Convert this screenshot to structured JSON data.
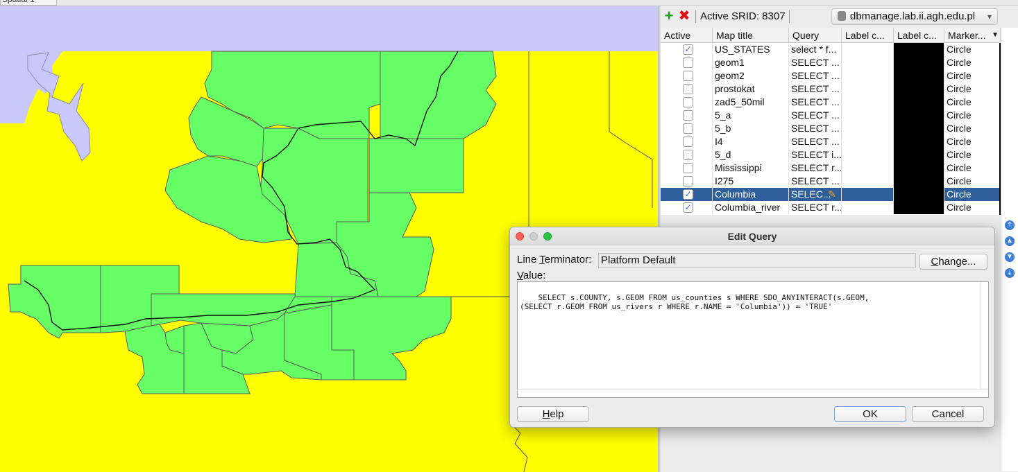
{
  "tab": {
    "label": "Spatial 1"
  },
  "toolbar": {
    "add_icon": "plus-icon",
    "remove_icon": "delete-x-icon",
    "active_srid": "Active SRID: 8307",
    "connection": "dbmanage.lab.ii.agh.edu.pl"
  },
  "table": {
    "headers": [
      "Active",
      "Map title",
      "Query",
      "Label c...",
      "Label c...",
      "Marker..."
    ],
    "rows": [
      {
        "active": true,
        "title": "US_STATES",
        "query": "select * f...",
        "marker": "Circle",
        "selected": false
      },
      {
        "active": false,
        "title": "geom1",
        "query": "SELECT ...",
        "marker": "Circle",
        "selected": false
      },
      {
        "active": false,
        "title": "geom2",
        "query": "SELECT ...",
        "marker": "Circle",
        "selected": false
      },
      {
        "active": false,
        "title": "prostokat",
        "query": "SELECT  ...",
        "marker": "Circle",
        "selected": false
      },
      {
        "active": false,
        "title": "zad5_50mil",
        "query": "SELECT ...",
        "marker": "Circle",
        "selected": false
      },
      {
        "active": false,
        "title": "5_a",
        "query": "SELECT ...",
        "marker": "Circle",
        "selected": false
      },
      {
        "active": false,
        "title": "5_b",
        "query": "SELECT ...",
        "marker": "Circle",
        "selected": false
      },
      {
        "active": false,
        "title": "I4",
        "query": "SELECT ...",
        "marker": "Circle",
        "selected": false
      },
      {
        "active": false,
        "title": "5_d",
        "query": "SELECT i...",
        "marker": "Circle",
        "selected": false
      },
      {
        "active": false,
        "title": "Mississippi",
        "query": "SELECT r...",
        "marker": "Circle",
        "selected": false
      },
      {
        "active": false,
        "title": "I275",
        "query": "SELECT ...",
        "marker": "Circle",
        "selected": false
      },
      {
        "active": true,
        "title": "Columbia",
        "query": "SELEC...",
        "marker": "Circle",
        "selected": true
      },
      {
        "active": true,
        "title": "Columbia_river",
        "query": "SELECT r...",
        "marker": "Circle",
        "selected": false
      }
    ]
  },
  "dialog": {
    "title": "Edit Query",
    "line_terminator_label_pre": "Line ",
    "line_terminator_label_mn": "T",
    "line_terminator_label_post": "erminator:",
    "line_terminator_value": "Platform Default",
    "change_button": "Change...",
    "change_button_mn": "C",
    "change_button_rest": "hange...",
    "value_label_mn": "V",
    "value_label_rest": "alue:",
    "query_text": "SELECT s.COUNTY, s.GEOM FROM us_counties s WHERE SDO_ANYINTERACT(s.GEOM,\n(SELECT r.GEOM FROM us_rivers r WHERE r.NAME = 'Columbia')) = 'TRUE'",
    "help_button_mn": "H",
    "help_button_rest": "elp",
    "ok_button": "OK",
    "cancel_button": "Cancel"
  },
  "colors": {
    "map_water": "#c8c8fa",
    "map_land": "#ffff00",
    "map_counties": "#66ff66",
    "selection": "#2f5f9a"
  }
}
